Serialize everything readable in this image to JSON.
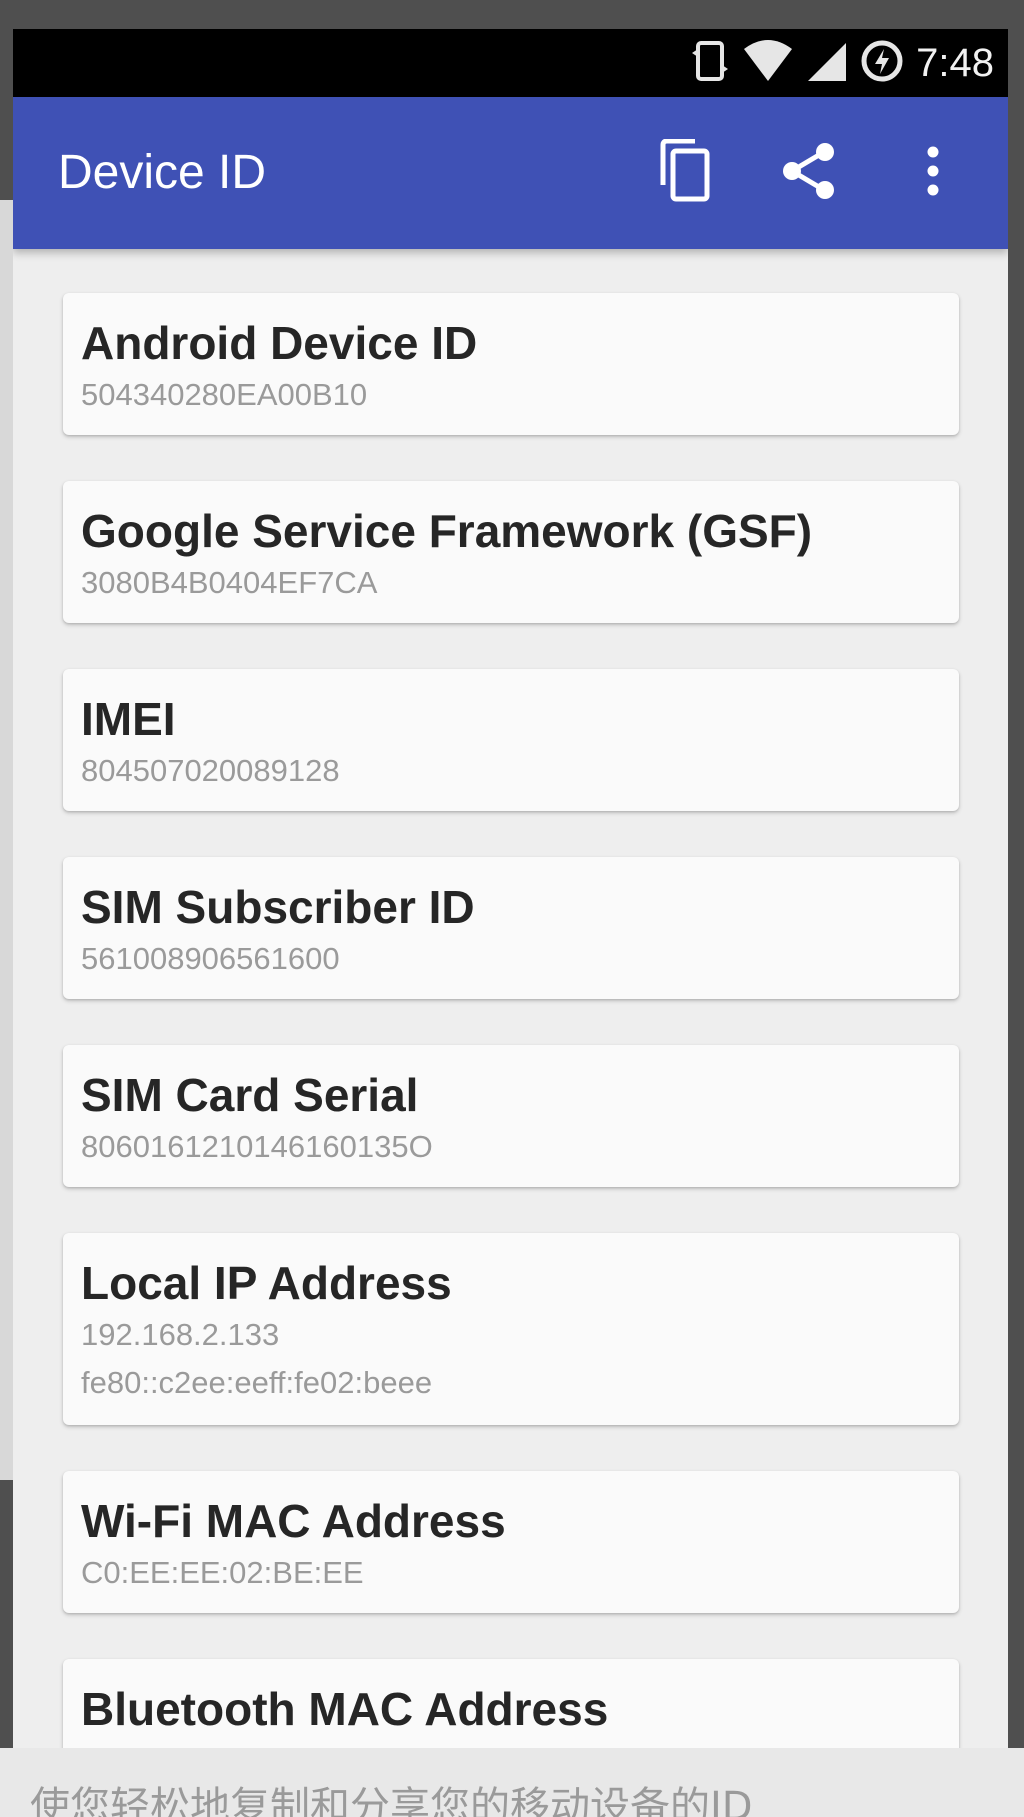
{
  "status_bar": {
    "time": "7:48",
    "icons": [
      "screen-rotate-icon",
      "wifi-icon",
      "cell-signal-icon",
      "data-saver-icon"
    ]
  },
  "app_bar": {
    "title": "Device ID",
    "actions": [
      "copy-icon",
      "share-icon",
      "more-vert-icon"
    ],
    "color": "#3f51b5"
  },
  "cards": [
    {
      "title": "Android Device ID",
      "values": [
        "504340280EA00B10"
      ]
    },
    {
      "title": "Google Service Framework (GSF)",
      "values": [
        "3080B4B0404EF7CA"
      ]
    },
    {
      "title": "IMEI",
      "values": [
        "804507020089128"
      ]
    },
    {
      "title": "SIM Subscriber ID",
      "values": [
        "561008906561600"
      ]
    },
    {
      "title": "SIM Card Serial",
      "values": [
        "8060161210146160135O"
      ]
    },
    {
      "title": "Local IP Address",
      "values": [
        "192.168.2.133",
        "fe80::c2ee:eeff:fe02:beee"
      ]
    },
    {
      "title": "Wi-Fi MAC Address",
      "values": [
        "C0:EE:EE:02:BE:EE"
      ]
    },
    {
      "title": "Bluetooth MAC Address",
      "values": []
    }
  ],
  "background_caption": "使您轻松地复制和分享您的移动设备的ID"
}
